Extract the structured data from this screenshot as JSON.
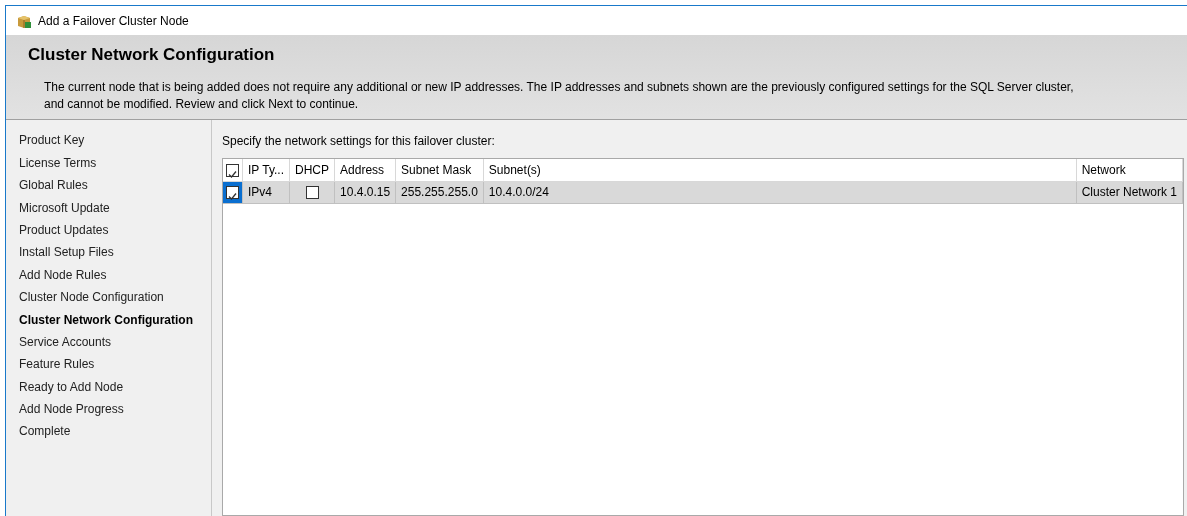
{
  "window": {
    "title": "Add a Failover Cluster Node"
  },
  "header": {
    "title": "Cluster Network Configuration",
    "description": "The current node that is being added does not require any additional or new IP addresses.  The IP addresses and subnets shown are the previously configured settings for the SQL Server cluster, and cannot be modified. Review and click Next to continue."
  },
  "steps": [
    {
      "label": "Product Key",
      "selected": false
    },
    {
      "label": "License Terms",
      "selected": false
    },
    {
      "label": "Global Rules",
      "selected": false
    },
    {
      "label": "Microsoft Update",
      "selected": false
    },
    {
      "label": "Product Updates",
      "selected": false
    },
    {
      "label": "Install Setup Files",
      "selected": false
    },
    {
      "label": "Add Node Rules",
      "selected": false
    },
    {
      "label": "Cluster Node Configuration",
      "selected": false
    },
    {
      "label": "Cluster Network Configuration",
      "selected": true
    },
    {
      "label": "Service Accounts",
      "selected": false
    },
    {
      "label": "Feature Rules",
      "selected": false
    },
    {
      "label": "Ready to Add Node",
      "selected": false
    },
    {
      "label": "Add Node Progress",
      "selected": false
    },
    {
      "label": "Complete",
      "selected": false
    }
  ],
  "content": {
    "instruction": "Specify the network settings for this failover cluster:"
  },
  "table": {
    "select_all_checked": true,
    "columns": [
      "IP Ty...",
      "DHCP",
      "Address",
      "Subnet Mask",
      "Subnet(s)",
      "Network"
    ],
    "rows": [
      {
        "selected": true,
        "checked": true,
        "ip_type": "IPv4",
        "dhcp": false,
        "address": "10.4.0.15",
        "subnet_mask": "255.255.255.0",
        "subnets": "10.4.0.0/24",
        "network": "Cluster Network 1"
      }
    ]
  }
}
